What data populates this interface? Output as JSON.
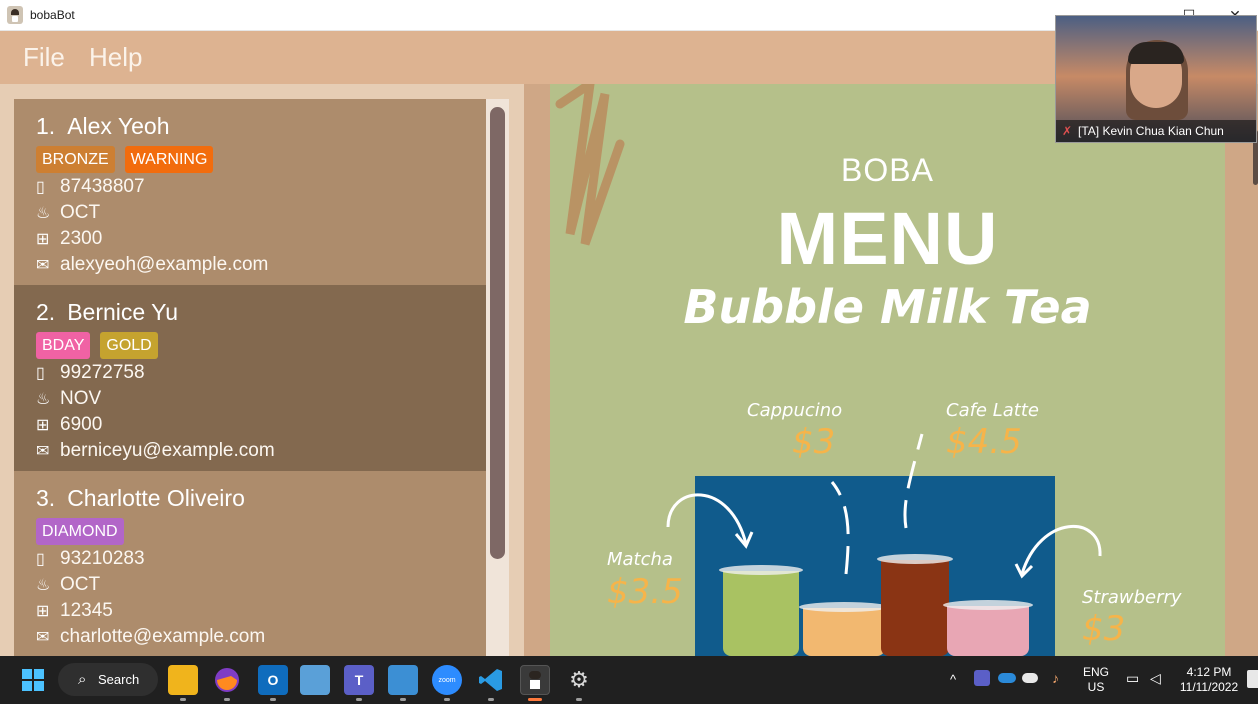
{
  "window": {
    "title": "bobaBot",
    "controls": [
      "—",
      "☐",
      "✕"
    ]
  },
  "menu": {
    "items": [
      "File",
      "Help"
    ]
  },
  "persons": [
    {
      "index": "1.",
      "name": "Alex Yeoh",
      "tags": [
        {
          "label": "BRONZE",
          "color": "#cd7f32"
        },
        {
          "label": "WARNING",
          "color": "#f26c0d"
        }
      ],
      "phone": "87438807",
      "birthday_month": "OCT",
      "reward_points": "2300",
      "email": "alexyeoh@example.com"
    },
    {
      "index": "2.",
      "name": "Bernice Yu",
      "tags": [
        {
          "label": "BDAY",
          "color": "#f062a4"
        },
        {
          "label": "GOLD",
          "color": "#c5a32f"
        }
      ],
      "phone": "99272758",
      "birthday_month": "NOV",
      "reward_points": "6900",
      "email": "berniceyu@example.com"
    },
    {
      "index": "3.",
      "name": "Charlotte Oliveiro",
      "tags": [
        {
          "label": "DIAMOND",
          "color": "#b266c8"
        }
      ],
      "phone": "93210283",
      "birthday_month": "OCT",
      "reward_points": "12345",
      "email": "charlotte@example.com"
    }
  ],
  "icons": {
    "phone": "phone-icon",
    "birthday": "cake-icon",
    "reward": "gift-icon",
    "email": "email-icon"
  },
  "menu_image": {
    "subtitle": "BOBA",
    "title": "MENU",
    "script_title": "Bubble Milk Tea",
    "items": [
      {
        "name": "Cappucino",
        "price": "$3"
      },
      {
        "name": "Cafe Latte",
        "price": "$4.5"
      },
      {
        "name": "Matcha",
        "price": "$3.5"
      },
      {
        "name": "Strawberry",
        "price": "$3"
      }
    ]
  },
  "video_call": {
    "participant": "[TA] Kevin Chua Kian Chun"
  },
  "taskbar": {
    "search_label": "Search",
    "language_line1": "ENG",
    "language_line2": "US",
    "time": "4:12 PM",
    "date": "11/11/2022"
  },
  "colors": {
    "menubar": "#ddb391",
    "card_light": "#ad8c6c",
    "card_selected": "#83694f",
    "menu_green": "#b5c08a",
    "price_orange": "#f6b44a"
  }
}
